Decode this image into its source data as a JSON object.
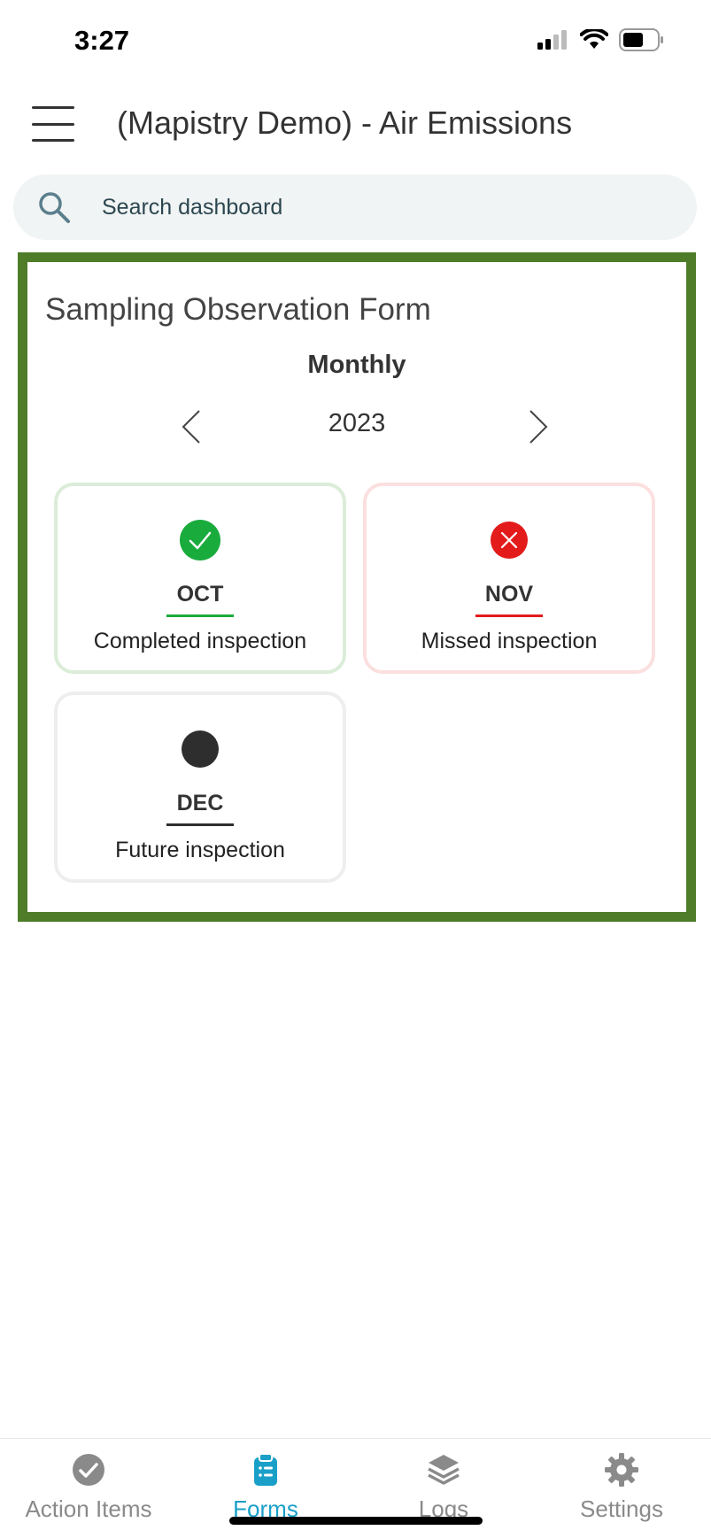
{
  "status_bar": {
    "time": "3:27"
  },
  "header": {
    "title": "(Mapistry Demo) - Air Emissions"
  },
  "search": {
    "placeholder": "Search dashboard",
    "icon": "search-icon"
  },
  "widget": {
    "title": "Sampling Observation Form",
    "period": "Monthly",
    "year": "2023",
    "months": [
      {
        "month": "OCT",
        "status": "Completed inspection",
        "state": "completed",
        "color": "#1aab3d"
      },
      {
        "month": "NOV",
        "status": "Missed inspection",
        "state": "missed",
        "color": "#e31b1b"
      },
      {
        "month": "DEC",
        "status": "Future inspection",
        "state": "future",
        "color": "#2e2e2e"
      }
    ]
  },
  "tabs": [
    {
      "label": "Action Items",
      "icon": "check-circle-icon",
      "active": false
    },
    {
      "label": "Forms",
      "icon": "clipboard-icon",
      "active": true
    },
    {
      "label": "Logs",
      "icon": "layers-icon",
      "active": false
    },
    {
      "label": "Settings",
      "icon": "gear-icon",
      "active": false
    }
  ],
  "colors": {
    "accent": "#1aa0c8",
    "card_border": "#4e7c28",
    "inactive_tab": "#8a8a8a"
  }
}
